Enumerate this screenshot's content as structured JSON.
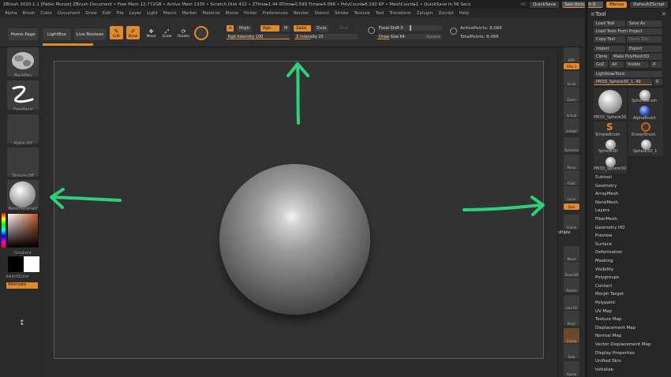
{
  "titlebar": {
    "title": "ZBrush 2020.1.1 [Pablo Munoz]   ZBrush Document    • Free Mem 12.772GB • Active Mem 1335 • Scratch Disk 422 • ZTime▸1.44 RTime▸0.599 Timer▸4.096 • PolyCount▸8.192 KP • MeshCount▸1   • QuickSave In 56 Secs",
    "ac_label": "AC",
    "quicksave": "QuickSave",
    "seethrough": "See-through  0",
    "menus": "Menus",
    "script": "DefaultZScript"
  },
  "menubar": [
    "Alpha",
    "Brush",
    "Color",
    "Document",
    "Draw",
    "Edit",
    "File",
    "Layer",
    "Light",
    "Macro",
    "Marker",
    "Material",
    "Movie",
    "Picker",
    "Preferences",
    "Render",
    "Stencil",
    "Stroke",
    "Texture",
    "Tool",
    "Transform",
    "Zplugin",
    "Zscript",
    "Help"
  ],
  "toolbar": {
    "home_page": "Home Page",
    "lightbox": "LightBox",
    "live_boolean": "Live Boolean",
    "edit": "Edit",
    "draw": "Draw",
    "move": "Move",
    "scale": "Scale",
    "rotate": "Rotate",
    "a": "A",
    "mrgb": "Mrgb",
    "rgb": "Rgb",
    "m": "M",
    "zadd": "Zadd",
    "zsub": "Zsub",
    "zcut": "Zcut",
    "rgb_intensity": "Rgb Intensity 100",
    "z_intensity": "Z Intensity 25",
    "focal_shift": "Focal Shift 0",
    "draw_size": "Draw Size 64",
    "dynamic": "Dynamic",
    "active_points": "ActivePoints: 8,066",
    "total_points": "TotalPoints: 8,066"
  },
  "left_shelf": {
    "brush": "MackPen",
    "stroke": "FreeHand",
    "alpha": "Alpha Off",
    "texture": "Texture Off",
    "material": "BasicMaterial2",
    "gradient": "Gradient",
    "switch_color": "SwitchColor",
    "alternate": "Alternate"
  },
  "right_shelf": {
    "bpr": "BPR",
    "spix": "SPix 3",
    "scroll": "Scroll",
    "zoom": "Zoom",
    "actual": "Actual",
    "aahalf": "AAHalf",
    "dynamic": "Dynamic",
    "persp": "Persp",
    "floor": "Floor",
    "local": "Local",
    "qviz": "Qviz",
    "frame": "Frame",
    "move": "Move",
    "zoom3d": "Zoom3D",
    "rotate": "Rotate",
    "line_fill": "Line Fill",
    "polyf": "PolyF",
    "transp": "Transp",
    "solo": "Solo",
    "xpose": "Xpose",
    "partial_label": "ultiple"
  },
  "tool_panel": {
    "title": "Tool",
    "load_tool": "Load Tool",
    "save_as": "Save As",
    "load_project": "Load Tools From Project",
    "copy_tool": "Copy Tool",
    "paste_tool": "Paste Tool",
    "import": "Import",
    "export": "Export",
    "clone": "Clone",
    "make_polymesh": "Make PolyMesh3D",
    "goz": "GoZ",
    "all": "All",
    "visible": "Visible",
    "r": "R",
    "lightbox_tools": "Lightbox▸Tools",
    "current_tool": "PM3D_Sphere3D_1. 49",
    "r2": "R",
    "tools": [
      "PM3D_Sphere3D",
      "SphereBrush",
      "AlphaBrush",
      "SimpleBrush",
      "EraserBrush",
      "Sphere3D",
      "Sphere3D_1",
      "PM3D_Sphere3D"
    ],
    "subpalettes": [
      "Subtool",
      "Geometry",
      "ArrayMesh",
      "NanoMesh",
      "Layers",
      "FiberMesh",
      "Geometry HD",
      "Preview",
      "Surface",
      "Deformation",
      "Masking",
      "Visibility",
      "Polygroups",
      "Contact",
      "Morph Target",
      "Polypaint",
      "UV Map",
      "Texture Map",
      "Displacement Map",
      "Normal Map",
      "Vector Displacement Map",
      "Display Properties",
      "Unified Skin",
      "Initialize"
    ]
  },
  "colors": {
    "accent": "#e08a2c",
    "annotation": "#2fd07a"
  }
}
